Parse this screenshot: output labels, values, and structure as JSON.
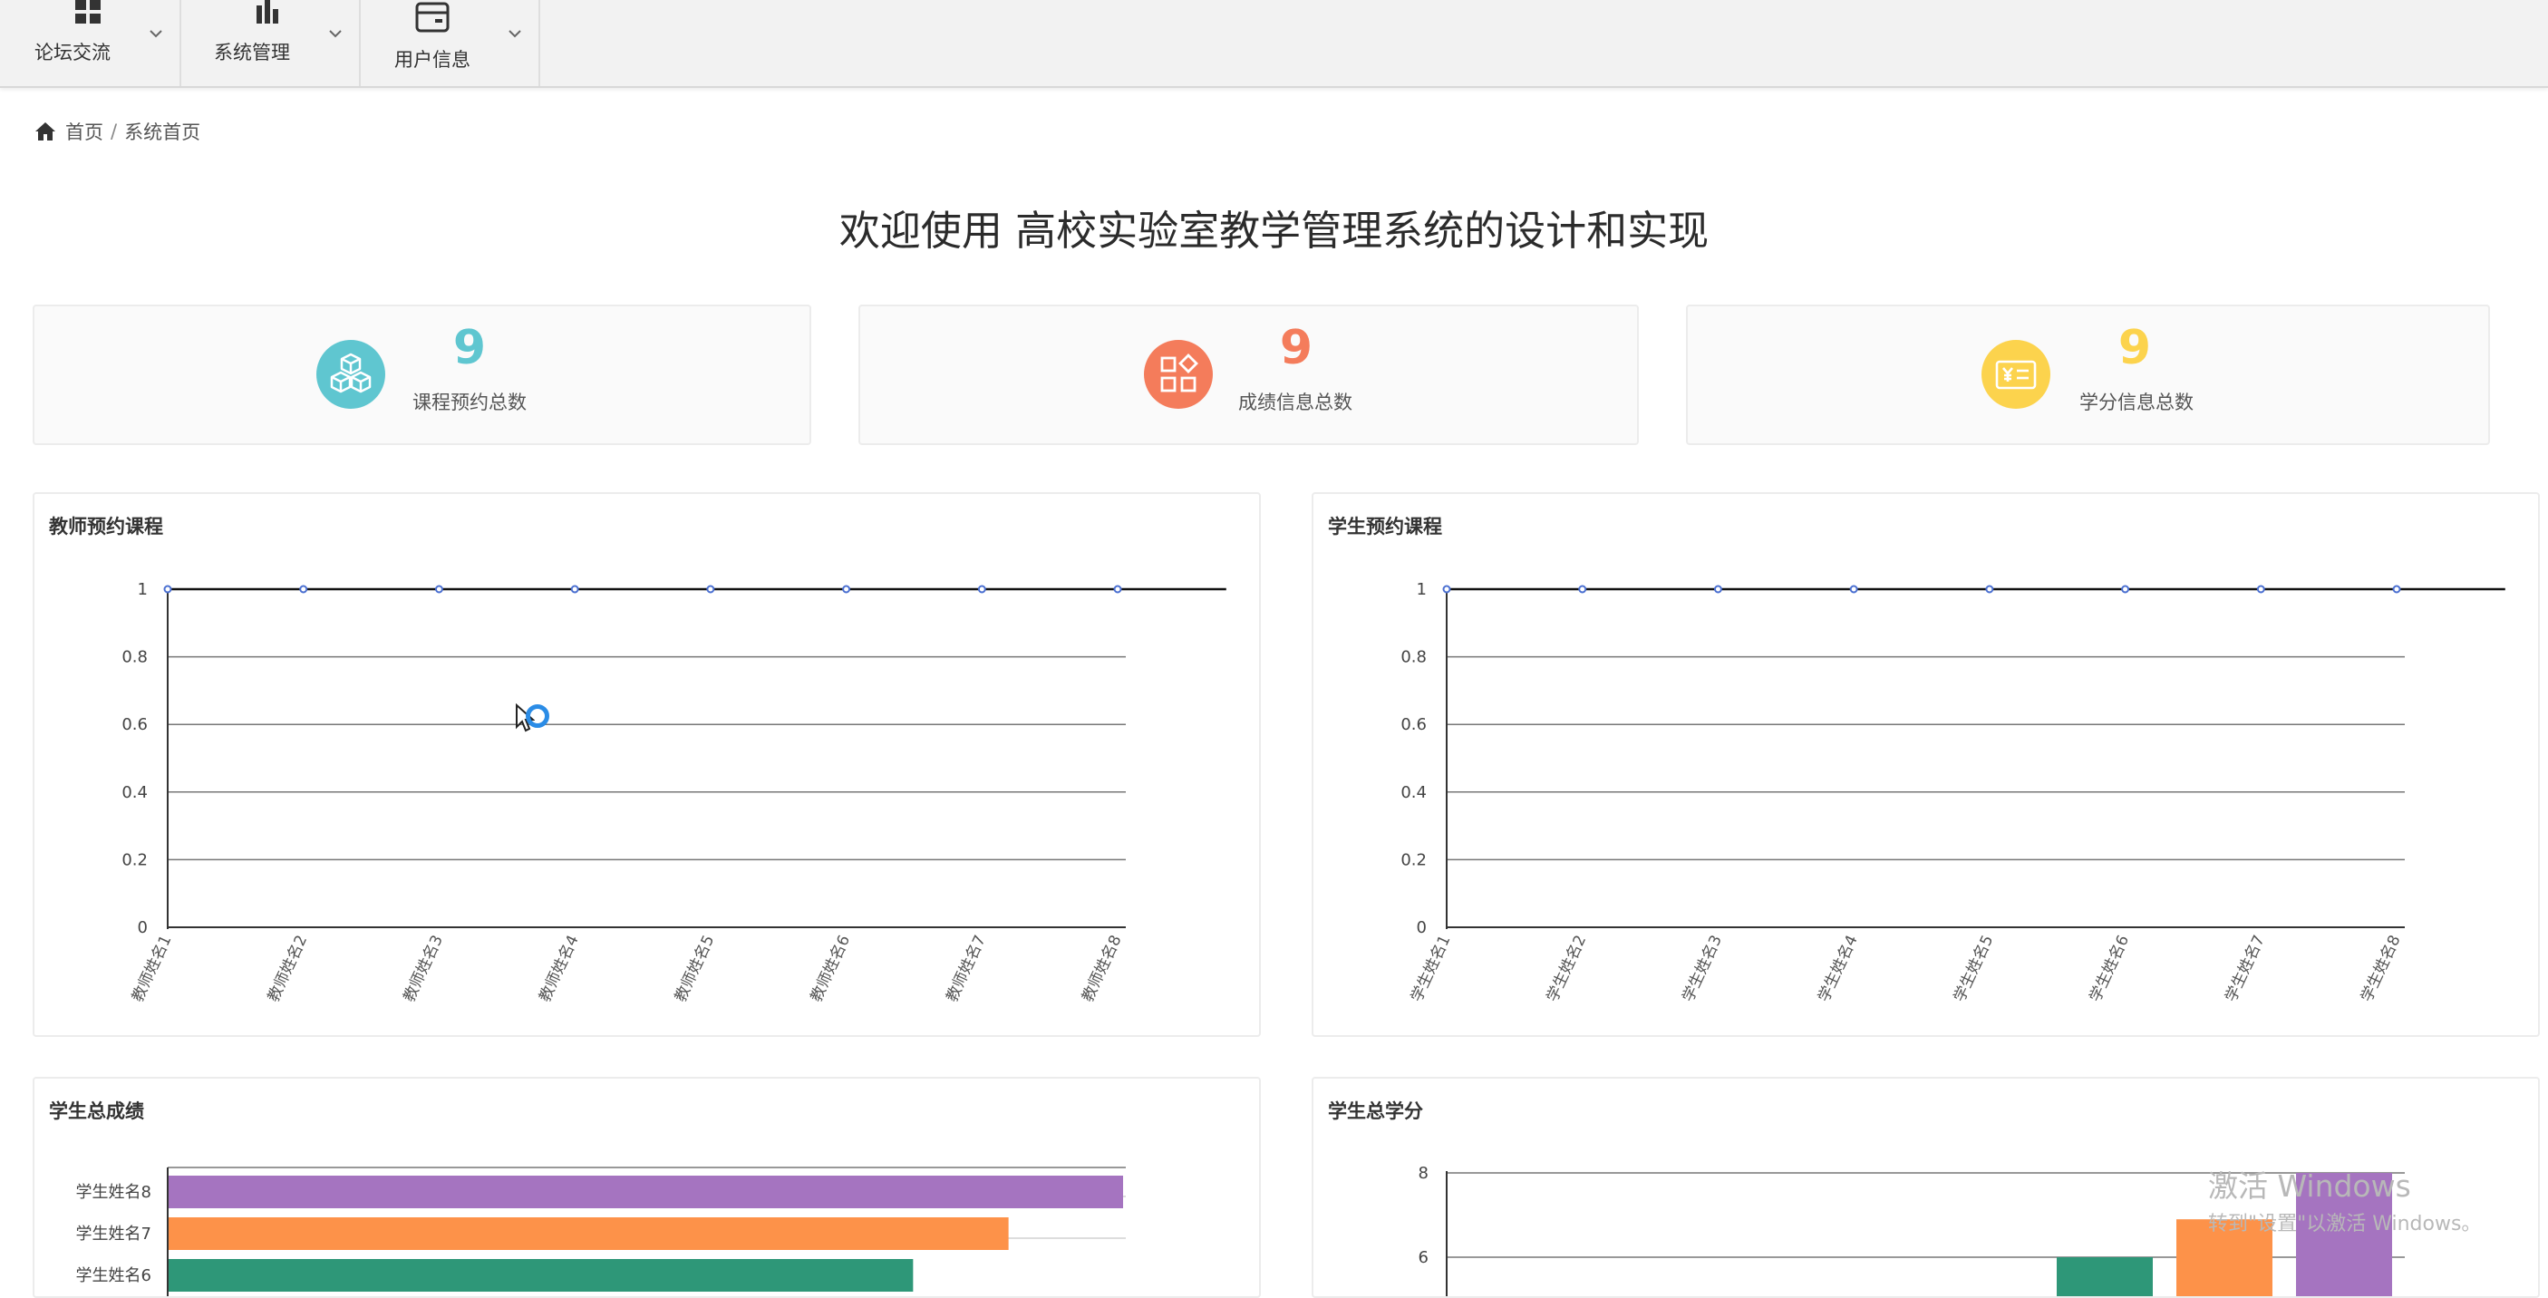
{
  "nav": {
    "items": [
      {
        "label": "论坛交流",
        "icon": "grid-icon"
      },
      {
        "label": "系统管理",
        "icon": "bar-chart-icon"
      },
      {
        "label": "用户信息",
        "icon": "card-icon"
      }
    ]
  },
  "breadcrumb": {
    "home": "首页",
    "separator": "/",
    "current": "系统首页"
  },
  "page": {
    "title": "欢迎使用 高校实验室教学管理系统的设计和实现"
  },
  "stats": [
    {
      "value": "9",
      "label": "课程预约总数",
      "icon": "cubes-icon",
      "color": "#5fc6d0"
    },
    {
      "value": "9",
      "label": "成绩信息总数",
      "icon": "apps-icon",
      "color": "#f47c5b"
    },
    {
      "value": "9",
      "label": "学分信息总数",
      "icon": "yuan-card-icon",
      "color": "#fcd34d"
    }
  ],
  "panels": {
    "teacher": {
      "title": "教师预约课程"
    },
    "student": {
      "title": "学生预约课程"
    },
    "score": {
      "title": "学生总成绩"
    },
    "credit": {
      "title": "学生总学分"
    }
  },
  "chart_data": [
    {
      "type": "line",
      "title": "教师预约课程",
      "categories": [
        "教师姓名1",
        "教师姓名2",
        "教师姓名3",
        "教师姓名4",
        "教师姓名5",
        "教师姓名6",
        "教师姓名7",
        "教师姓名8"
      ],
      "values": [
        1,
        1,
        1,
        1,
        1,
        1,
        1,
        1
      ],
      "yticks": [
        0,
        0.2,
        0.4,
        0.6,
        0.8,
        1
      ],
      "ylim": [
        0,
        1
      ]
    },
    {
      "type": "line",
      "title": "学生预约课程",
      "categories": [
        "学生姓名1",
        "学生姓名2",
        "学生姓名3",
        "学生姓名4",
        "学生姓名5",
        "学生姓名6",
        "学生姓名7",
        "学生姓名8"
      ],
      "values": [
        1,
        1,
        1,
        1,
        1,
        1,
        1,
        1
      ],
      "yticks": [
        0,
        0.2,
        0.4,
        0.6,
        0.8,
        1
      ],
      "ylim": [
        0,
        1
      ]
    },
    {
      "type": "bar",
      "orientation": "horizontal",
      "title": "学生总成绩",
      "visible_categories": [
        "学生姓名8",
        "学生姓名7",
        "学生姓名6"
      ],
      "values": [
        100,
        88,
        78
      ],
      "xlim": [
        0,
        100
      ],
      "colors": [
        "#a574c0",
        "#fd9249",
        "#2e9778"
      ]
    },
    {
      "type": "bar",
      "title": "学生总学分",
      "yticks": [
        6,
        8
      ],
      "ylim": [
        0,
        8
      ],
      "visible_bars": [
        {
          "value": 6.0,
          "color": "#2e9778"
        },
        {
          "value": 6.9,
          "color": "#fd9249"
        },
        {
          "value": 8.0,
          "color": "#a574c0"
        }
      ]
    }
  ],
  "watermark": {
    "line1": "激活 Windows",
    "line2": "转到\"设置\"以激活 Windows。"
  }
}
